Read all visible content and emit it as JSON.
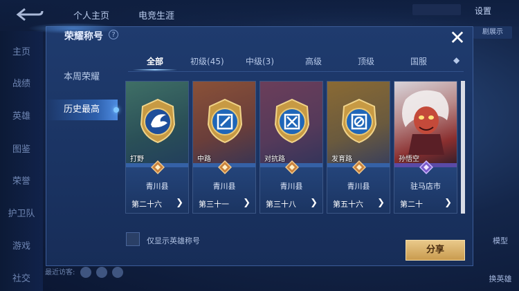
{
  "background": {
    "tabs": [
      "个人主页",
      "电竞生涯"
    ],
    "settings_label": "设置",
    "chip_text": "",
    "chip2_text": "剧展示",
    "left_nav": [
      "主页",
      "战绩",
      "英雄",
      "图鉴",
      "荣誉",
      "护卫队",
      "游戏",
      "社交"
    ],
    "right_buttons": [
      "模型",
      "换英雄"
    ],
    "recent_visitors_label": "最近访客:"
  },
  "modal": {
    "title": "荣耀称号",
    "help_icon": "?",
    "close_icon": "✕",
    "side_items": [
      "本周荣耀",
      "历史最高"
    ],
    "active_side_index": 1,
    "tabs": [
      "全部",
      "初级(45)",
      "中级(3)",
      "高级",
      "顶级",
      "国服",
      "◆"
    ],
    "active_tab_index": 0,
    "cards": [
      {
        "position": "打野",
        "region": "青川县",
        "rank": "第二十六",
        "arrow": "❯",
        "theme": "jungle"
      },
      {
        "position": "中路",
        "region": "青川县",
        "rank": "第三十一",
        "arrow": "❯",
        "theme": "mid"
      },
      {
        "position": "对抗路",
        "region": "青川县",
        "rank": "第三十八",
        "arrow": "❯",
        "theme": "clash"
      },
      {
        "position": "发育路",
        "region": "青川县",
        "rank": "第五十六",
        "arrow": "❯",
        "theme": "farm"
      },
      {
        "position": "孙悟空",
        "region": "驻马店市",
        "rank": "第二十",
        "arrow": "❯",
        "theme": "hero"
      }
    ],
    "checkbox_label": "仅显示英雄称号",
    "share_label": "分享"
  },
  "colors": {
    "accent": "#7fc7ff",
    "share_gold": "#d8b06a",
    "modal_bg": "#1c3666"
  }
}
